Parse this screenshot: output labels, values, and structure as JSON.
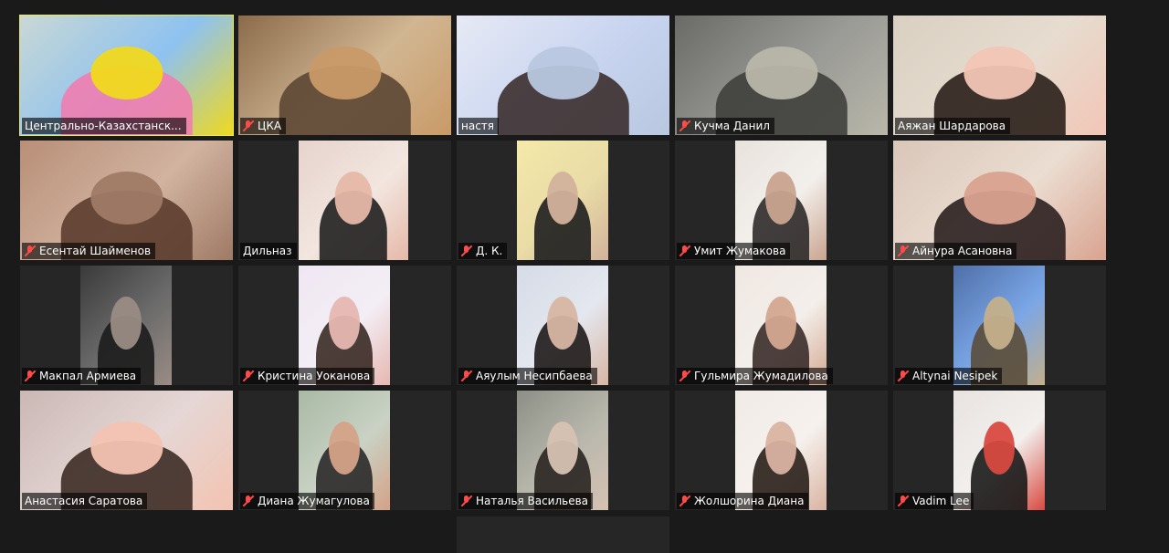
{
  "participants": [
    {
      "name": "Центрально-Казахстанск...",
      "muted": false,
      "active": true,
      "video": "full",
      "colors": [
        "#c9d8d5",
        "#8ec2f0",
        "#ef7db0",
        "#f0d91e"
      ]
    },
    {
      "name": "ЦКА",
      "muted": true,
      "active": false,
      "video": "full",
      "colors": [
        "#8b6b4a",
        "#d1b692",
        "#5c4734",
        "#c99a68"
      ]
    },
    {
      "name": "настя",
      "muted": false,
      "active": false,
      "video": "full",
      "colors": [
        "#e7eaf5",
        "#c8d4f0",
        "#3b2d2d",
        "#b8c8df"
      ]
    },
    {
      "name": "Кучма Данил",
      "muted": true,
      "active": false,
      "video": "full",
      "colors": [
        "#6a6a66",
        "#9a9a96",
        "#3f3f3c",
        "#b9b7aa"
      ]
    },
    {
      "name": "Аяжан Шардарова",
      "muted": false,
      "active": false,
      "video": "full",
      "colors": [
        "#d9d0c2",
        "#e6dccf",
        "#2a1f19",
        "#f2c6b6"
      ]
    },
    {
      "name": "Есентай Шайменов",
      "muted": true,
      "active": false,
      "video": "full",
      "colors": [
        "#b98f78",
        "#d1b3a0",
        "#5b3c2e",
        "#9f7a65"
      ]
    },
    {
      "name": "Дильназ",
      "muted": false,
      "active": false,
      "video": "leftpart",
      "colors": [
        "#e6d3cc",
        "#f2e6df",
        "#202020",
        "#e6b8a8"
      ]
    },
    {
      "name": "Д. К.",
      "muted": true,
      "active": false,
      "video": "center",
      "colors": [
        "#f5e8a9",
        "#e9dca6",
        "#1e1e1e",
        "#d2b29c"
      ]
    },
    {
      "name": "Умит Жумакова",
      "muted": true,
      "active": false,
      "video": "center",
      "colors": [
        "#e8e2dc",
        "#f3f0ec",
        "#2d2a2a",
        "#c9a48f"
      ]
    },
    {
      "name": "Айнура Асановна",
      "muted": true,
      "active": false,
      "video": "full",
      "colors": [
        "#d9c7b9",
        "#ebddd1",
        "#2b2020",
        "#d9a38f"
      ]
    },
    {
      "name": "Макпал Армиева",
      "muted": true,
      "active": false,
      "video": "center",
      "colors": [
        "#3a3a3a",
        "#6c6c6c",
        "#1c1c1c",
        "#9a8c85"
      ]
    },
    {
      "name": "Кристина Уоканова",
      "muted": true,
      "active": false,
      "video": "center",
      "colors": [
        "#efe7f2",
        "#f3eef5",
        "#3a2a25",
        "#e6b7b1"
      ]
    },
    {
      "name": "Аяулым Несипбаева",
      "muted": true,
      "active": false,
      "video": "center",
      "colors": [
        "#d6dbe6",
        "#e4e7ef",
        "#1f1a1a",
        "#d7b6a3"
      ]
    },
    {
      "name": "Гульмира Жумадилова",
      "muted": true,
      "active": false,
      "video": "center",
      "colors": [
        "#efe7e2",
        "#f4efeb",
        "#3a2c2a",
        "#d4a891"
      ]
    },
    {
      "name": "Altynai Nesipek",
      "muted": true,
      "active": false,
      "video": "center",
      "colors": [
        "#4f6fa8",
        "#7aa6e6",
        "#5a4c3a",
        "#c4b08b"
      ]
    },
    {
      "name": "Анастасия Саратова",
      "muted": false,
      "active": false,
      "video": "full",
      "colors": [
        "#cbb8b5",
        "#e5d7d5",
        "#3d2c26",
        "#f3c3b1"
      ]
    },
    {
      "name": "Диана Жумагулова",
      "muted": true,
      "active": false,
      "video": "center",
      "colors": [
        "#a9b9a4",
        "#c9d2c4",
        "#2a2a2a",
        "#d4a287"
      ]
    },
    {
      "name": "Наталья Васильева",
      "muted": true,
      "active": false,
      "video": "center",
      "colors": [
        "#8c8f86",
        "#b9b8ad",
        "#2a2521",
        "#d6c2b2"
      ]
    },
    {
      "name": "Жолшорина Диана",
      "muted": true,
      "active": false,
      "video": "center",
      "colors": [
        "#f0ebe6",
        "#f6f1ec",
        "#2a1f1a",
        "#d9b3a2"
      ]
    },
    {
      "name": "Vadim Lee",
      "muted": true,
      "active": false,
      "video": "center",
      "colors": [
        "#e8e3e0",
        "#f2efed",
        "#1a1a1a",
        "#d84a40"
      ]
    }
  ]
}
